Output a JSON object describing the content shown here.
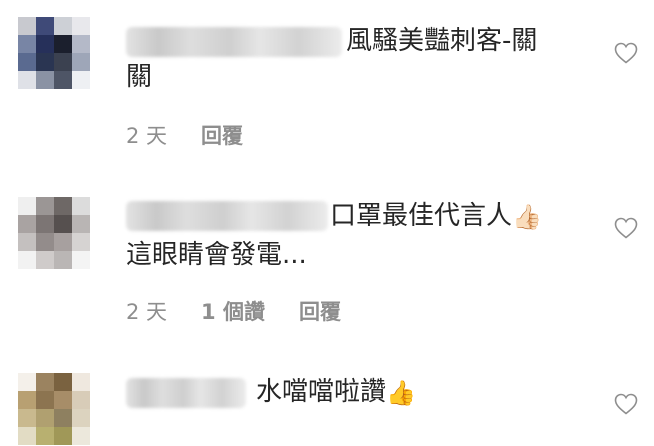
{
  "comments": [
    {
      "text_line1": "風騷美豔刺客-",
      "text_line1b": "關",
      "text_line2": "關",
      "time": "2 天",
      "likes": "",
      "reply": "回覆",
      "avatar_colors": [
        "#c8c9cf",
        "#3f4a78",
        "#cdd0d6",
        "#e8e8ec",
        "#7885a5",
        "#26305a",
        "#1b1f2d",
        "#b4b9c8",
        "#5a6a90",
        "#2a3552",
        "#3b4150",
        "#9ea6b8",
        "#dfe1e7",
        "#8a92a4",
        "#4e5566",
        "#eef0f3"
      ]
    },
    {
      "text_line1": "口罩最佳代言人",
      "text_line1b": "👍🏻",
      "text_line2": "這眼睛會發電...",
      "time": "2 天",
      "likes": "1 個讚",
      "reply": "回覆",
      "avatar_colors": [
        "#efefef",
        "#9b9695",
        "#6e6866",
        "#dcdcdc",
        "#a9a3a2",
        "#7c7574",
        "#56504f",
        "#b9b5b4",
        "#c4c0bf",
        "#938c8b",
        "#a7a09f",
        "#d6d3d2",
        "#f2f2f2",
        "#cfcbca",
        "#bab6b5",
        "#f4f4f4"
      ]
    },
    {
      "text_line1": "水噹噹啦讚",
      "text_line1b": "👍",
      "avatar_colors": [
        "#f4f0ea",
        "#9b8360",
        "#7a6240",
        "#efe8df",
        "#b8a072",
        "#8c7450",
        "#a78d68",
        "#d8ccb8",
        "#c9b98e",
        "#b0a070",
        "#8e8060",
        "#dcd3bf",
        "#e2dcc4",
        "#b8b070",
        "#a09858",
        "#ece8dc"
      ]
    }
  ]
}
